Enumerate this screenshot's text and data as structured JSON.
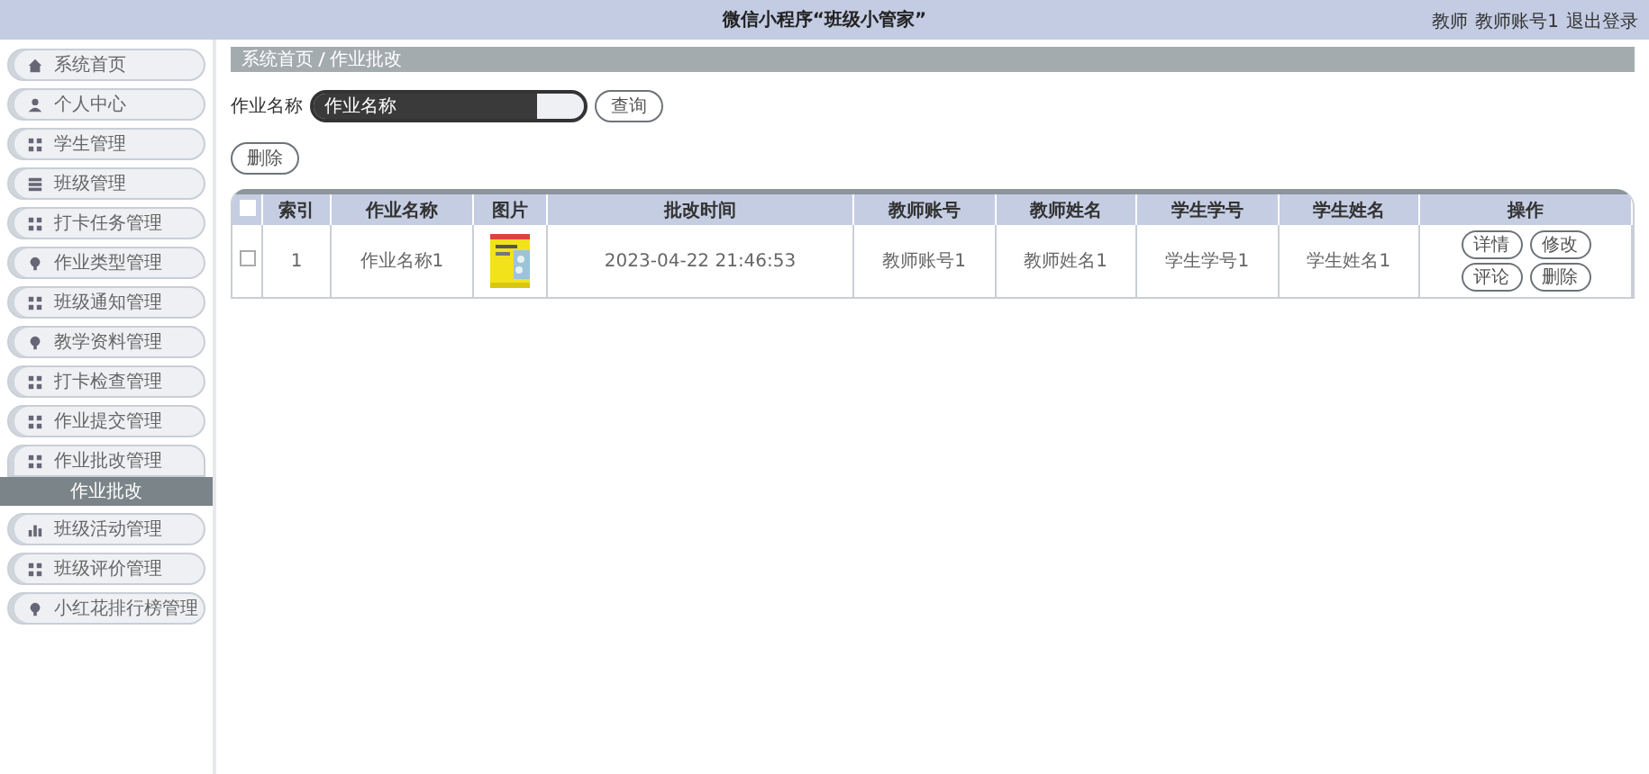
{
  "header": {
    "title": "微信小程序“班级小管家”",
    "user_role": "教师",
    "user_name": "教师账号1",
    "logout": "退出登录"
  },
  "sidebar": {
    "items": [
      {
        "label": "系统首页",
        "kind": "home",
        "expanded": false
      },
      {
        "label": "个人中心",
        "kind": "person",
        "expanded": false
      },
      {
        "label": "学生管理",
        "kind": "grid",
        "expanded": false
      },
      {
        "label": "班级管理",
        "kind": "list",
        "expanded": false
      },
      {
        "label": "打卡任务管理",
        "kind": "grid",
        "expanded": false
      },
      {
        "label": "作业类型管理",
        "kind": "pin",
        "expanded": false
      },
      {
        "label": "班级通知管理",
        "kind": "grid",
        "expanded": false
      },
      {
        "label": "教学资料管理",
        "kind": "pin",
        "expanded": false
      },
      {
        "label": "打卡检查管理",
        "kind": "grid",
        "expanded": false
      },
      {
        "label": "作业提交管理",
        "kind": "grid",
        "expanded": false
      },
      {
        "label": "作业批改管理",
        "kind": "grid",
        "expanded": true,
        "children": [
          {
            "label": "作业批改",
            "selected": true
          }
        ]
      },
      {
        "label": "班级活动管理",
        "kind": "chart",
        "expanded": false
      },
      {
        "label": "班级评价管理",
        "kind": "grid",
        "expanded": false
      },
      {
        "label": "小红花排行榜管理",
        "kind": "pin",
        "expanded": false
      }
    ]
  },
  "breadcrumb": [
    "系统首页",
    "作业批改"
  ],
  "search": {
    "label": "作业名称",
    "placeholder": "作业名称",
    "button": "查询"
  },
  "delete_button": "删除",
  "table": {
    "select_all": false,
    "columns": [
      "索引",
      "作业名称",
      "图片",
      "批改时间",
      "教师账号",
      "教师姓名",
      "学生学号",
      "学生姓名",
      "操作"
    ],
    "rows": [
      {
        "checked": false,
        "cells": [
          {
            "kind": "text",
            "text": "1"
          },
          {
            "kind": "text",
            "text": "作业名称1"
          },
          {
            "kind": "picture"
          },
          {
            "kind": "text",
            "text": "2023-04-22 21:46:53"
          },
          {
            "kind": "text",
            "text": "教师账号1"
          },
          {
            "kind": "text",
            "text": "教师姓名1"
          },
          {
            "kind": "text",
            "text": "学生学号1"
          },
          {
            "kind": "text",
            "text": "学生姓名1"
          },
          {
            "kind": "actions",
            "buttons": [
              "详情",
              "修改",
              "评论",
              "删除"
            ]
          }
        ]
      }
    ]
  }
}
